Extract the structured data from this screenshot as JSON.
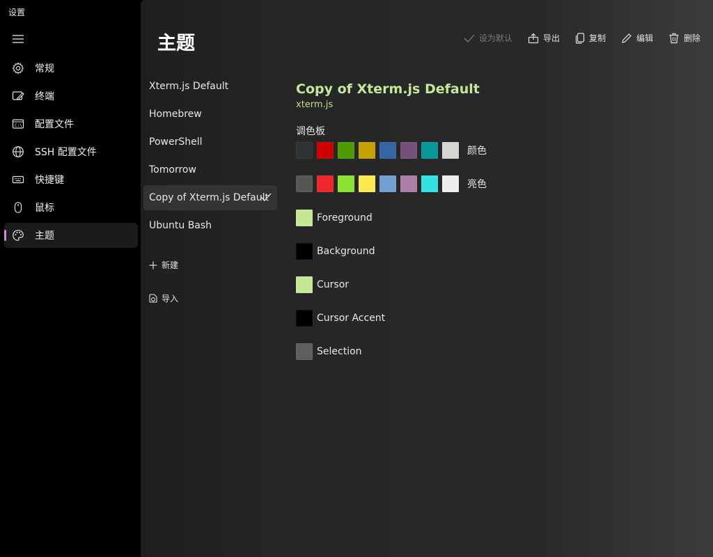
{
  "window": {
    "title": "设置",
    "minimize_icon": "minimize-icon",
    "maximize_icon": "maximize-icon",
    "close_icon": "close-icon"
  },
  "sidebar": {
    "menu_icon": "hamburger-icon",
    "items": [
      {
        "label": "常规",
        "icon": "gear-icon",
        "active": false
      },
      {
        "label": "终端",
        "icon": "terminal-pen-icon",
        "active": false
      },
      {
        "label": "配置文件",
        "icon": "console-icon",
        "active": false
      },
      {
        "label": "SSH 配置文件",
        "icon": "globe-icon",
        "active": false
      },
      {
        "label": "快捷键",
        "icon": "keyboard-icon",
        "active": false
      },
      {
        "label": "鼠标",
        "icon": "mouse-icon",
        "active": false
      },
      {
        "label": "主题",
        "icon": "palette-icon",
        "active": true
      }
    ],
    "accent_color": "#d08ad8"
  },
  "page": {
    "title": "主题"
  },
  "toolbar": {
    "set_default": "设为默认",
    "export": "导出",
    "copy": "复制",
    "edit": "编辑",
    "delete": "删除"
  },
  "themes": {
    "items": [
      {
        "label": "Xterm.js Default",
        "selected": false
      },
      {
        "label": "Homebrew",
        "selected": false
      },
      {
        "label": "PowerShell",
        "selected": false
      },
      {
        "label": "Tomorrow",
        "selected": false
      },
      {
        "label": "Copy of Xterm.js Default",
        "selected": true
      },
      {
        "label": "Ubuntu Bash",
        "selected": false
      }
    ],
    "new_label": "新建",
    "import_label": "导入"
  },
  "details": {
    "title": "Copy of Xterm.js Default",
    "subtitle": "xterm.js",
    "palette_label": "调色板",
    "normal_label": "颜色",
    "bright_label": "亮色",
    "normal_colors": [
      "#2e3436",
      "#cc0000",
      "#4e9a06",
      "#c4a000",
      "#3465a4",
      "#75507b",
      "#06989a",
      "#d3d7cf"
    ],
    "bright_colors": [
      "#555753",
      "#ef2929",
      "#8ae234",
      "#fce94f",
      "#729fcf",
      "#ad7fa8",
      "#34e2e2",
      "#eeeeec"
    ],
    "named": [
      {
        "label": "Foreground",
        "color": "#c5e896"
      },
      {
        "label": "Background",
        "color": "#000000"
      },
      {
        "label": "Cursor",
        "color": "#c5e896"
      },
      {
        "label": "Cursor Accent",
        "color": "#000000"
      },
      {
        "label": "Selection",
        "color": "#5e5e5e"
      }
    ],
    "title_color": "#c5e896"
  }
}
